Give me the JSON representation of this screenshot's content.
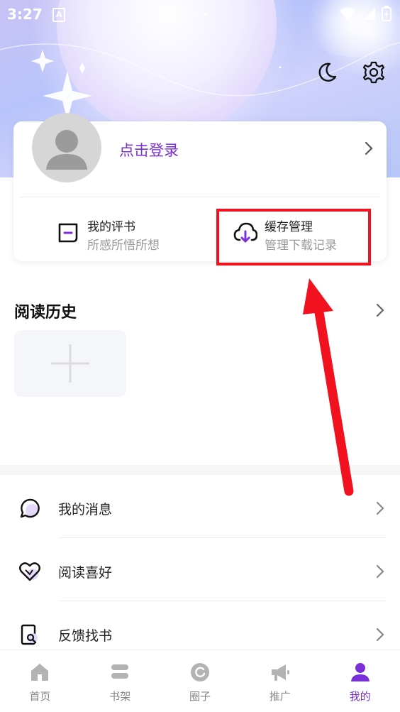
{
  "status_bar": {
    "time": "3:27",
    "notification_icon": "A"
  },
  "header": {
    "night_mode_icon": "moon-icon",
    "settings_icon": "gear-icon"
  },
  "profile_card": {
    "login_text": "点击登录",
    "features": [
      {
        "title": "我的评书",
        "subtitle": "所感所悟所想",
        "icon": "comment-icon"
      },
      {
        "title": "缓存管理",
        "subtitle": "管理下载记录",
        "icon": "cloud-download-icon"
      }
    ]
  },
  "history": {
    "title": "阅读历史"
  },
  "menu": [
    {
      "label": "我的消息",
      "icon": "message-icon"
    },
    {
      "label": "阅读喜好",
      "icon": "heart-icon"
    },
    {
      "label": "反馈找书",
      "icon": "search-book-icon"
    }
  ],
  "tabs": [
    {
      "label": "首页",
      "icon": "home-icon"
    },
    {
      "label": "书架",
      "icon": "bookshelf-icon"
    },
    {
      "label": "圈子",
      "icon": "circle-icon"
    },
    {
      "label": "推广",
      "icon": "megaphone-icon"
    },
    {
      "label": "我的",
      "icon": "user-icon",
      "active": true
    }
  ],
  "colors": {
    "accent": "#7a2fd8",
    "annotation": "#f2121f"
  }
}
